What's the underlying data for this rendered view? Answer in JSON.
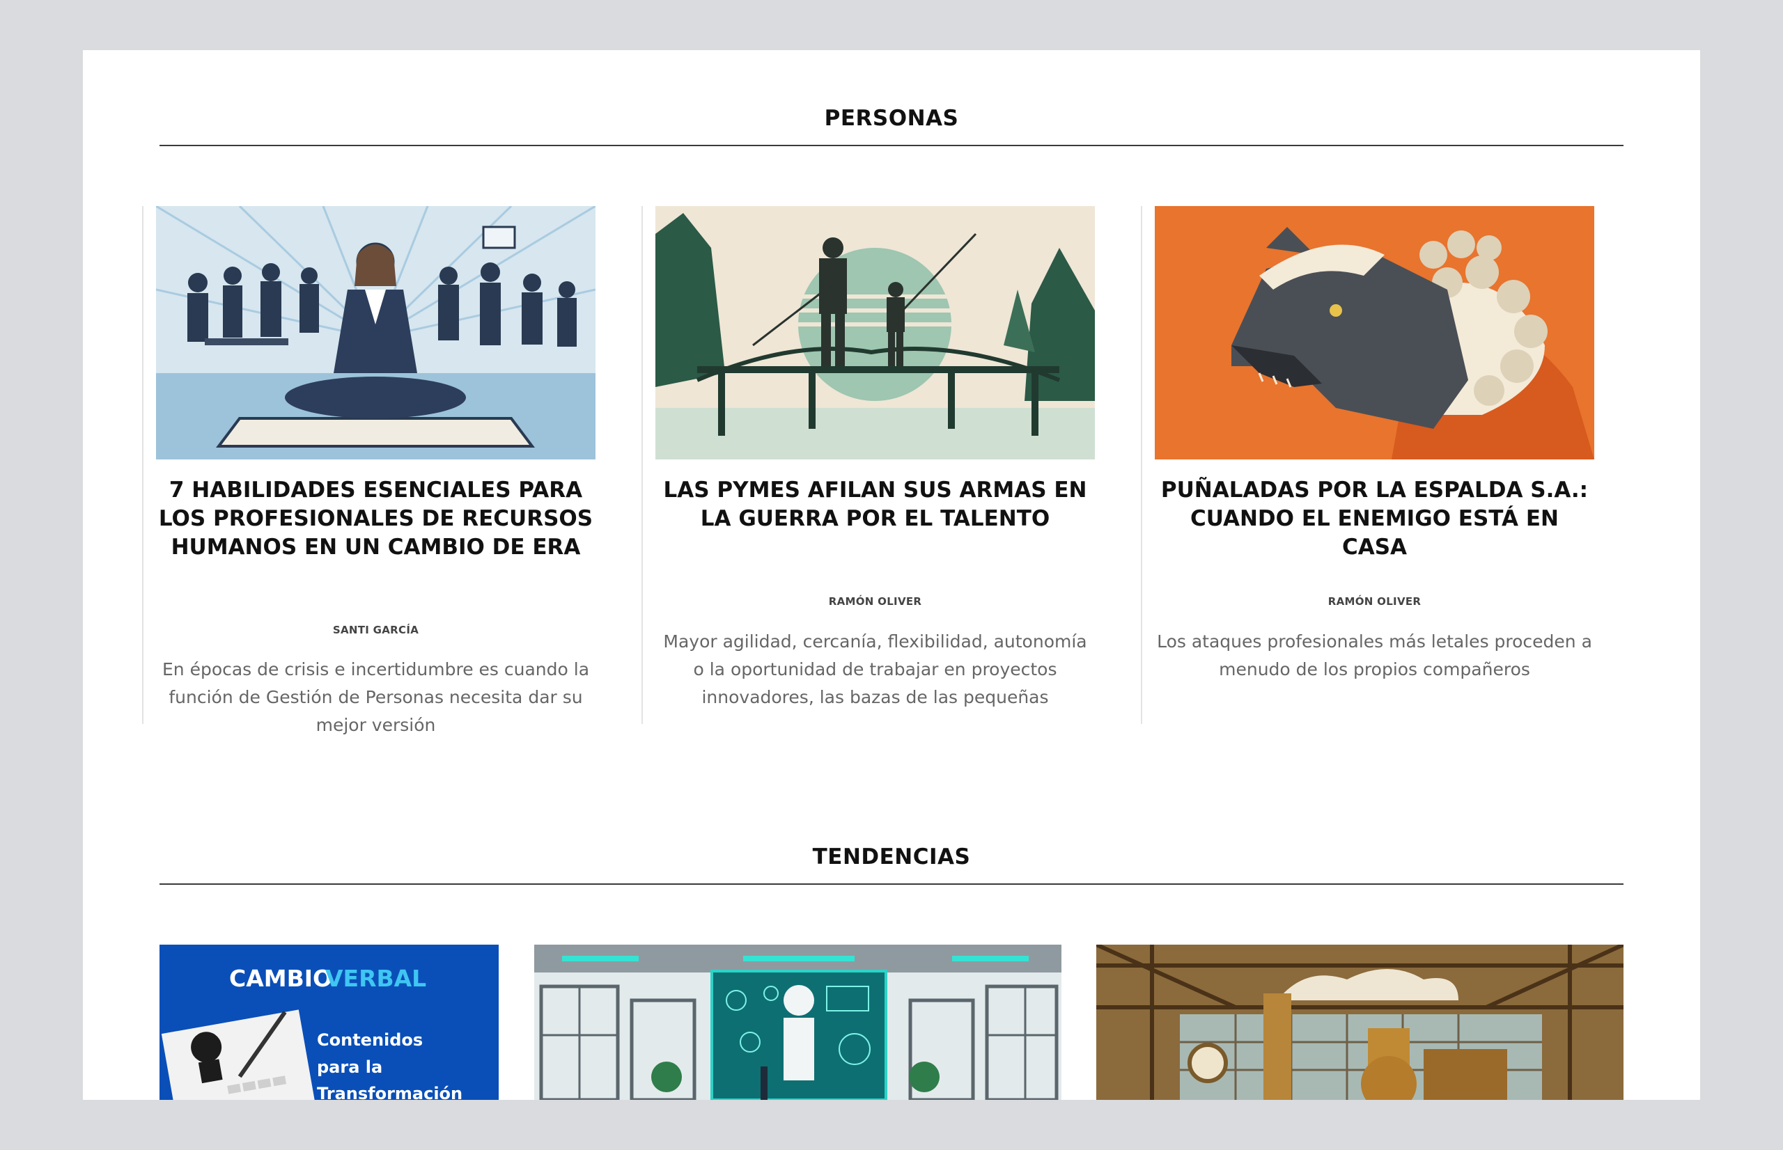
{
  "sections": {
    "personas": {
      "title": "PERSONAS",
      "articles": [
        {
          "title": "7 HABILIDADES ESENCIALES PARA LOS PROFESIONALES DE RECURSOS HUMANOS EN UN CAMBIO DE ERA",
          "author": "SANTI GARCÍA",
          "excerpt": "En épocas de crisis e incertidumbre es cuando la función de Gestión de Personas necesita dar su mejor versión",
          "image": "meditating-businesswoman-illustration"
        },
        {
          "title": "LAS PYMES AFILAN SUS ARMAS EN LA GUERRA POR EL TALENTO",
          "author": "RAMÓN OLIVER",
          "excerpt": "Mayor agilidad, cercanía, flexibilidad, autonomía o la oportunidad de trabajar en proyectos innovadores, las bazas de las pequeñas",
          "image": "fishing-on-bridge-illustration"
        },
        {
          "title": "PUÑALADAS POR LA ESPALDA S.A.: CUANDO EL ENEMIGO ESTÁ EN CASA",
          "author": "RAMÓN OLIVER",
          "excerpt": "Los ataques profesionales más letales proceden a menudo de los propios compañeros",
          "image": "wolf-in-sheep-clothing-illustration"
        }
      ]
    },
    "tendencias": {
      "title": "TENDENCIAS",
      "cards": [
        {
          "banner_word1": "CAMBIO",
          "banner_word2": "VERBAL",
          "banner_line1": "Contenidos",
          "banner_line2": "para la",
          "banner_line3": "Transformación",
          "image": "cambio-verbal-banner"
        },
        {
          "image": "ai-robot-office-illustration"
        },
        {
          "image": "steampunk-factory-illustration"
        }
      ]
    }
  },
  "colors": {
    "banner_blue": "#0a4fb8",
    "banner_accent": "#3fc6f2",
    "orange": "#e8742e"
  }
}
